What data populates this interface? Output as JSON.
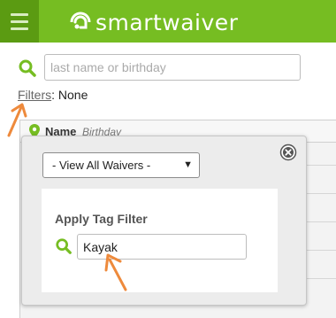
{
  "header": {
    "brand_name": "smartwaiver",
    "menu_icon": "hamburger-menu-icon",
    "logo_icon": "smartwaiver-logo-icon",
    "brand_color": "#76bd22",
    "menu_color": "#5b9b12"
  },
  "search": {
    "placeholder": "last name or birthday",
    "value": "",
    "icon": "search-icon"
  },
  "filters": {
    "label": "Filters",
    "separator": ":",
    "value": "None"
  },
  "table": {
    "columns": {
      "name": "Name",
      "birthday": "Birthday"
    },
    "pin_icon": "location-pin-icon"
  },
  "filter_popup": {
    "waiver_select": {
      "selected": "- View All Waivers -",
      "caret": "▼"
    },
    "close_icon": "close-icon",
    "tag_filter": {
      "title": "Apply Tag Filter",
      "value": "Kayak",
      "icon": "search-icon"
    }
  },
  "annotations": {
    "arrow_color": "#ee8a3c",
    "arrows": [
      "pointer-arrow-filters",
      "pointer-arrow-tag-input"
    ]
  }
}
